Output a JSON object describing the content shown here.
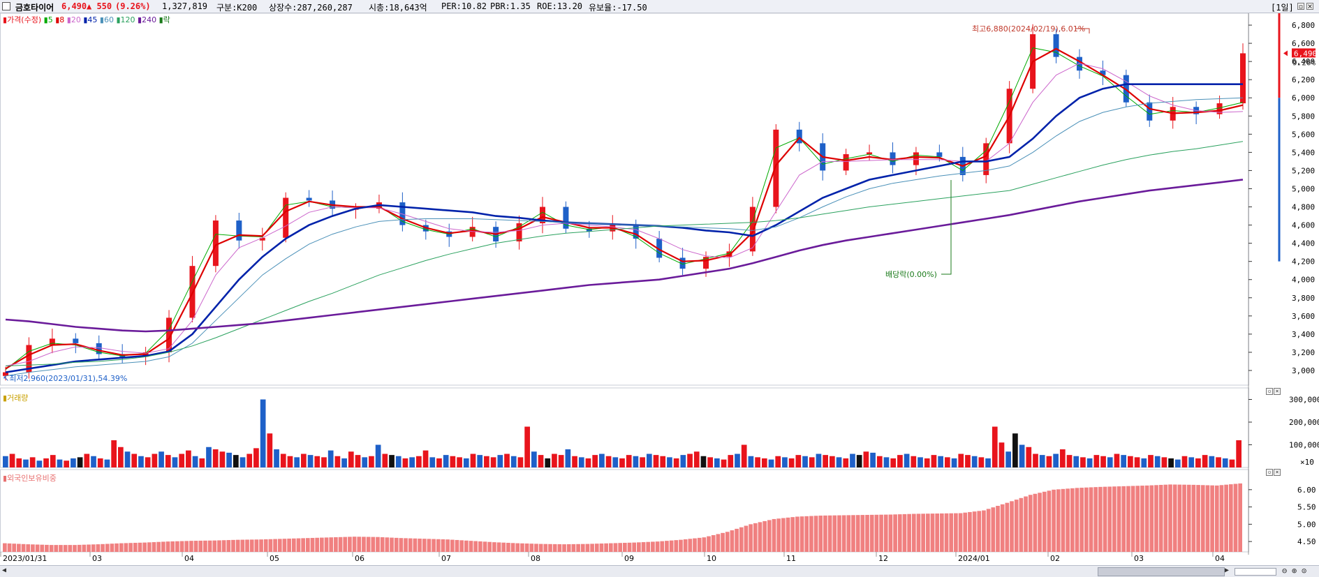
{
  "header": {
    "stock_name": "금호타이어",
    "price": "6,490",
    "change": "▲ 550",
    "change_pct": "(9.26%)",
    "volume": "1,327,819",
    "category": "구분:K200",
    "shares": "상장수:287,260,287",
    "market_cap": "시총:18,643억",
    "per": "PER:10.82",
    "pbr": "PBR:1.35",
    "roe": "ROE:13.20",
    "yield": "유보율:-17.50",
    "period": "[1일]"
  },
  "legend": {
    "price_label": "가격(수정)",
    "ma": [
      {
        "label": "5",
        "color": "#00aa00"
      },
      {
        "label": "8",
        "color": "#dd0000"
      },
      {
        "label": "20",
        "color": "#cc66cc"
      },
      {
        "label": "45",
        "color": "#0022aa"
      },
      {
        "label": "60",
        "color": "#4a90b8"
      },
      {
        "label": "120",
        "color": "#2aa15e"
      },
      {
        "label": "240",
        "color": "#6a1b9a"
      },
      {
        "label": "락",
        "color": "#1a7a1a"
      }
    ],
    "volume_label": "거래량",
    "foreign_label": "외국인보유비중"
  },
  "annotations": {
    "high": "최고6,880(2024/02/19),6.01%",
    "low": "최저2,960(2023/01/31),54.39%",
    "dividend": "배당락(0.00%)",
    "current_price": "6,490",
    "current_pct": "9.26%",
    "volume_unit": "×10"
  },
  "colors": {
    "up": "#e8141c",
    "down": "#1e60c8",
    "ma5": "#00aa00",
    "ma8": "#dd0000",
    "ma20": "#cc66cc",
    "ma45": "#0022aa",
    "ma60": "#4a90b8",
    "ma120": "#2aa15e",
    "ma240": "#6a1b9a",
    "foreign": "#f08080"
  },
  "chart_data": [
    {
      "type": "line",
      "title": "",
      "x": [
        "2023/01/31",
        "03",
        "04",
        "05",
        "06",
        "07",
        "08",
        "09",
        "10",
        "11",
        "12",
        "2024/01",
        "02",
        "03",
        "04"
      ],
      "series": [
        {
          "name": "가격(수정)",
          "values": [
            2980,
            3280,
            3350,
            3300,
            3180,
            3150,
            3200,
            3580,
            4150,
            4650,
            4430,
            4460,
            4900,
            4870,
            4780,
            4780,
            4850,
            4600,
            4530,
            4470,
            4580,
            4420,
            4620,
            4800,
            4560,
            4530,
            4600,
            4450,
            4240,
            4120,
            4250,
            4310,
            4800,
            5650,
            5500,
            5200,
            5380,
            5400,
            5260,
            5400,
            5350,
            5150,
            5500,
            6100,
            6700,
            6450,
            6300,
            6250,
            5950,
            5750,
            5900,
            5820,
            5940,
            6490
          ]
        },
        {
          "name": "5",
          "values": [
            3010,
            3210,
            3300,
            3280,
            3200,
            3160,
            3190,
            3450,
            3980,
            4500,
            4480,
            4470,
            4820,
            4860,
            4800,
            4790,
            4810,
            4640,
            4550,
            4500,
            4560,
            4470,
            4580,
            4740,
            4600,
            4550,
            4580,
            4470,
            4290,
            4170,
            4230,
            4290,
            4640,
            5450,
            5560,
            5270,
            5330,
            5380,
            5300,
            5370,
            5350,
            5200,
            5420,
            5960,
            6550,
            6500,
            6350,
            6240,
            6020,
            5820,
            5860,
            5840,
            5890,
            5950
          ]
        },
        {
          "name": "8",
          "values": [
            3020,
            3170,
            3280,
            3290,
            3220,
            3170,
            3180,
            3350,
            3850,
            4380,
            4490,
            4480,
            4750,
            4860,
            4820,
            4800,
            4800,
            4670,
            4570,
            4510,
            4540,
            4500,
            4560,
            4690,
            4630,
            4570,
            4570,
            4500,
            4330,
            4200,
            4210,
            4270,
            4520,
            5260,
            5560,
            5350,
            5310,
            5350,
            5320,
            5350,
            5340,
            5250,
            5360,
            5800,
            6400,
            6540,
            6400,
            6250,
            6090,
            5880,
            5830,
            5840,
            5860,
            5920
          ]
        },
        {
          "name": "20",
          "values": [
            3050,
            3100,
            3200,
            3260,
            3250,
            3210,
            3190,
            3240,
            3550,
            4050,
            4350,
            4460,
            4590,
            4740,
            4800,
            4790,
            4790,
            4720,
            4640,
            4560,
            4530,
            4520,
            4540,
            4600,
            4620,
            4600,
            4580,
            4550,
            4450,
            4330,
            4260,
            4240,
            4350,
            4750,
            5150,
            5300,
            5300,
            5310,
            5320,
            5320,
            5320,
            5300,
            5300,
            5500,
            5950,
            6250,
            6380,
            6320,
            6180,
            6020,
            5920,
            5860,
            5840,
            5850
          ]
        },
        {
          "name": "45",
          "values": [
            2980,
            3020,
            3060,
            3100,
            3120,
            3140,
            3160,
            3210,
            3400,
            3700,
            4000,
            4250,
            4450,
            4600,
            4700,
            4780,
            4820,
            4800,
            4780,
            4760,
            4740,
            4700,
            4680,
            4650,
            4630,
            4620,
            4610,
            4600,
            4590,
            4570,
            4540,
            4520,
            4480,
            4600,
            4750,
            4900,
            5000,
            5100,
            5150,
            5200,
            5250,
            5300,
            5300,
            5350,
            5550,
            5800,
            6000,
            6100,
            6150,
            6150,
            6150,
            6150,
            6150,
            6150
          ]
        },
        {
          "name": "60",
          "values": [
            2940,
            2980,
            3010,
            3040,
            3060,
            3080,
            3100,
            3150,
            3300,
            3550,
            3800,
            4050,
            4230,
            4390,
            4500,
            4580,
            4640,
            4660,
            4670,
            4670,
            4670,
            4660,
            4650,
            4640,
            4630,
            4620,
            4610,
            4600,
            4590,
            4580,
            4570,
            4560,
            4540,
            4580,
            4680,
            4800,
            4910,
            5000,
            5060,
            5100,
            5140,
            5170,
            5200,
            5250,
            5400,
            5580,
            5740,
            5840,
            5900,
            5940,
            5960,
            5980,
            5990,
            6000
          ]
        },
        {
          "name": "120",
          "values": [
            3050,
            3060,
            3070,
            3090,
            3100,
            3120,
            3150,
            3200,
            3270,
            3360,
            3460,
            3560,
            3660,
            3760,
            3850,
            3950,
            4050,
            4130,
            4210,
            4280,
            4340,
            4400,
            4440,
            4480,
            4510,
            4530,
            4550,
            4570,
            4590,
            4600,
            4610,
            4620,
            4630,
            4650,
            4680,
            4720,
            4760,
            4800,
            4830,
            4860,
            4890,
            4920,
            4950,
            4980,
            5050,
            5120,
            5190,
            5260,
            5320,
            5370,
            5410,
            5440,
            5480,
            5520
          ]
        },
        {
          "name": "240",
          "values": [
            3560,
            3540,
            3510,
            3480,
            3460,
            3440,
            3430,
            3440,
            3460,
            3480,
            3500,
            3520,
            3550,
            3580,
            3610,
            3640,
            3670,
            3700,
            3730,
            3760,
            3790,
            3820,
            3850,
            3880,
            3910,
            3940,
            3960,
            3980,
            4000,
            4040,
            4080,
            4120,
            4180,
            4250,
            4320,
            4380,
            4430,
            4470,
            4510,
            4550,
            4590,
            4630,
            4670,
            4710,
            4760,
            4810,
            4860,
            4900,
            4940,
            4980,
            5010,
            5040,
            5070,
            5100
          ]
        }
      ],
      "ylim": [
        2900,
        6900
      ],
      "yticks": [
        "6,800",
        "6,600",
        "6,400",
        "6,200",
        "6,000",
        "5,800",
        "5,600",
        "5,400",
        "5,200",
        "5,000",
        "4,800",
        "4,600",
        "4,400",
        "4,200",
        "4,000",
        "3,800",
        "3,600",
        "3,400",
        "3,200",
        "3,000"
      ]
    },
    {
      "type": "bar",
      "title": "거래량",
      "values": [
        50,
        60,
        40,
        35,
        45,
        30,
        40,
        55,
        35,
        30,
        40,
        45,
        60,
        50,
        40,
        35,
        120,
        90,
        70,
        60,
        50,
        45,
        60,
        70,
        55,
        45,
        60,
        75,
        50,
        40,
        90,
        80,
        70,
        65,
        55,
        45,
        60,
        85,
        300,
        150,
        80,
        60,
        50,
        45,
        60,
        55,
        50,
        45,
        75,
        50,
        40,
        70,
        55,
        45,
        50,
        100,
        60,
        55,
        50,
        40,
        45,
        50,
        75,
        45,
        40,
        55,
        50,
        45,
        40,
        60,
        55,
        50,
        45,
        55,
        60,
        50,
        45,
        180,
        70,
        55,
        40,
        60,
        55,
        80,
        50,
        45,
        40,
        55,
        60,
        50,
        45,
        40,
        55,
        50,
        45,
        60,
        55,
        50,
        45,
        40,
        55,
        60,
        70,
        50,
        45,
        40,
        35,
        55,
        60,
        100,
        50,
        45,
        40,
        35,
        50,
        45,
        40,
        55,
        50,
        45,
        60,
        55,
        50,
        45,
        40,
        60,
        55,
        70,
        65,
        50,
        45,
        40,
        55,
        60,
        50,
        45,
        40,
        55,
        50,
        45,
        40,
        60,
        55,
        50,
        45,
        40,
        180,
        110,
        70,
        150,
        100,
        90,
        60,
        55,
        50,
        60,
        80,
        55,
        50,
        45,
        40,
        55,
        50,
        45,
        60,
        55,
        50,
        45,
        40,
        55,
        50,
        45,
        40,
        35,
        50,
        45,
        40,
        55,
        50,
        45,
        40,
        35,
        120
      ],
      "ylim": [
        0,
        320000
      ],
      "yticks": [
        "300,000",
        "200,000",
        "100,000"
      ]
    },
    {
      "type": "area",
      "title": "외국인보유비중",
      "values": [
        4.45,
        4.42,
        4.4,
        4.4,
        4.42,
        4.45,
        4.47,
        4.5,
        4.52,
        4.53,
        4.55,
        4.56,
        4.58,
        4.6,
        4.62,
        4.64,
        4.63,
        4.6,
        4.58,
        4.56,
        4.52,
        4.48,
        4.45,
        4.43,
        4.42,
        4.43,
        4.45,
        4.47,
        4.5,
        4.55,
        4.62,
        4.78,
        5.0,
        5.15,
        5.22,
        5.25,
        5.26,
        5.27,
        5.28,
        5.3,
        5.31,
        5.32,
        5.4,
        5.62,
        5.85,
        6.0,
        6.05,
        6.08,
        6.1,
        6.12,
        6.15,
        6.14,
        6.12,
        6.18
      ],
      "ylim": [
        4.2,
        6.4
      ],
      "yticks": [
        "6.00",
        "5.50",
        "5.00",
        "4.50"
      ]
    }
  ]
}
